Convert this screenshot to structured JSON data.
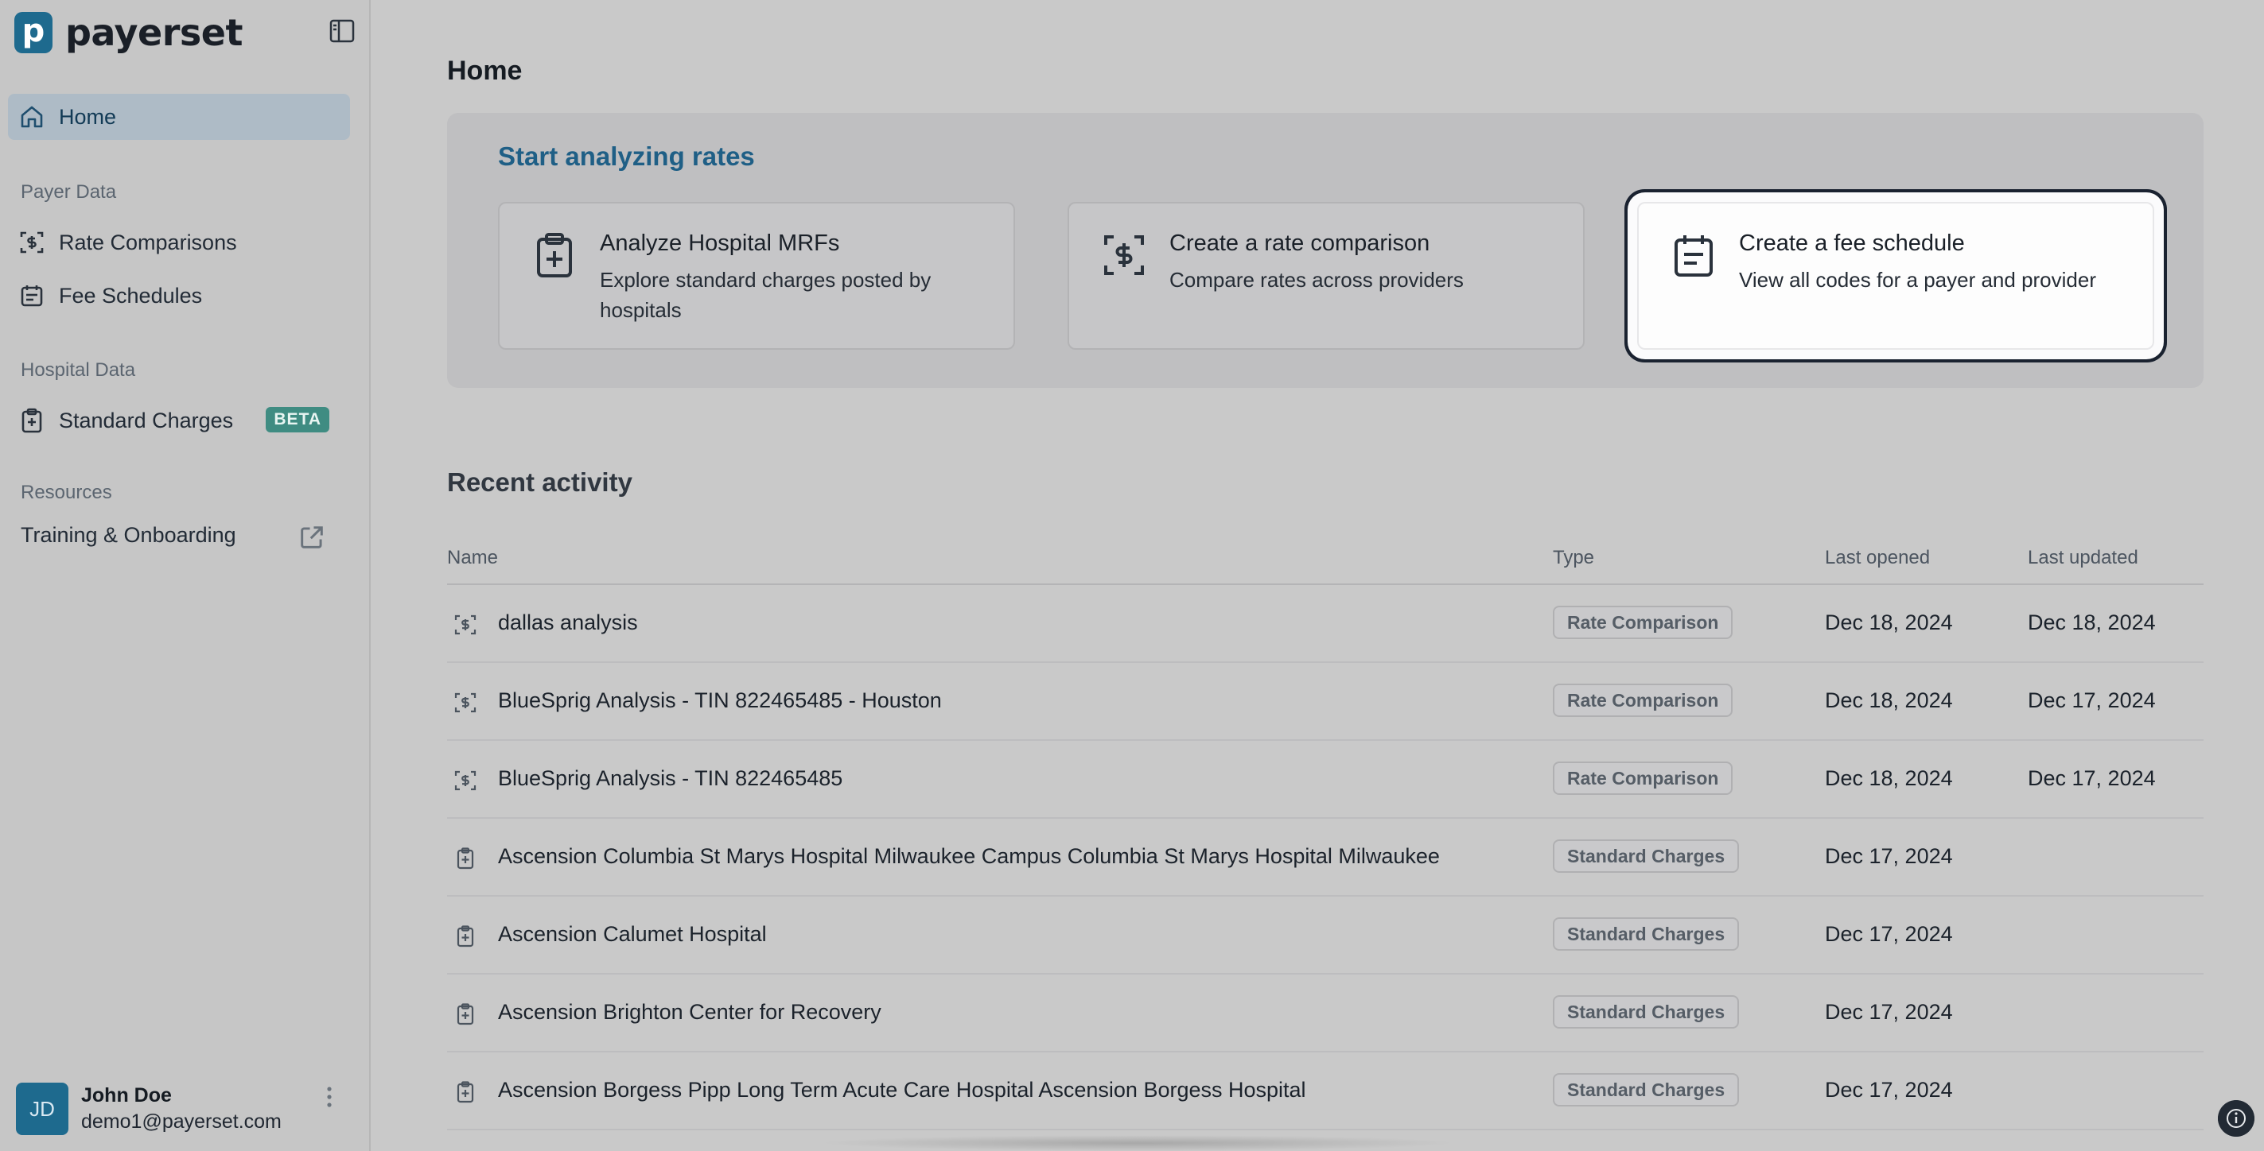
{
  "app": {
    "name": "payerset",
    "logo_letter": "p"
  },
  "sidebar": {
    "home_label": "Home",
    "sections": [
      {
        "label": "Payer Data",
        "items": [
          {
            "label": "Rate Comparisons",
            "icon": "dollar-scan-icon"
          },
          {
            "label": "Fee Schedules",
            "icon": "calendar-list-icon"
          }
        ]
      },
      {
        "label": "Hospital Data",
        "items": [
          {
            "label": "Standard Charges",
            "icon": "clipboard-plus-icon",
            "badge": "BETA"
          }
        ]
      },
      {
        "label": "Resources",
        "items": [
          {
            "label": "Training & Onboarding",
            "icon": "external-link-icon"
          }
        ]
      }
    ],
    "user": {
      "initials": "JD",
      "name": "John Doe",
      "email": "demo1@payerset.com"
    }
  },
  "main": {
    "title": "Home",
    "hero": {
      "title": "Start analyzing rates",
      "cards": [
        {
          "title": "Analyze Hospital MRFs",
          "desc": "Explore standard charges posted by hospitals",
          "icon": "clipboard-plus-icon"
        },
        {
          "title": "Create a rate comparison",
          "desc": "Compare rates across providers",
          "icon": "dollar-scan-icon"
        },
        {
          "title": "Create a fee schedule",
          "desc": "View all codes for a payer and provider",
          "icon": "calendar-list-icon"
        }
      ]
    },
    "recent": {
      "title": "Recent activity",
      "columns": [
        "Name",
        "Type",
        "Last opened",
        "Last updated"
      ],
      "rows": [
        {
          "name": "dallas analysis",
          "type": "Rate Comparison",
          "opened": "Dec 18, 2024",
          "updated": "Dec 18, 2024"
        },
        {
          "name": "BlueSprig Analysis - TIN 822465485 - Houston",
          "type": "Rate Comparison",
          "opened": "Dec 18, 2024",
          "updated": "Dec 17, 2024"
        },
        {
          "name": "BlueSprig Analysis - TIN 822465485",
          "type": "Rate Comparison",
          "opened": "Dec 18, 2024",
          "updated": "Dec 17, 2024"
        },
        {
          "name": "Ascension Columbia St Marys Hospital Milwaukee Campus Columbia St Marys Hospital Milwaukee",
          "type": "Standard Charges",
          "opened": "Dec 17, 2024",
          "updated": ""
        },
        {
          "name": "Ascension Calumet Hospital",
          "type": "Standard Charges",
          "opened": "Dec 17, 2024",
          "updated": ""
        },
        {
          "name": "Ascension Brighton Center for Recovery",
          "type": "Standard Charges",
          "opened": "Dec 17, 2024",
          "updated": ""
        },
        {
          "name": "Ascension Borgess Pipp Long Term Acute Care Hospital Ascension Borgess Hospital",
          "type": "Standard Charges",
          "opened": "Dec 17, 2024",
          "updated": ""
        }
      ]
    }
  },
  "colors": {
    "brand": "#1e6a8e",
    "beta": "#3f8c82",
    "hero_title": "#1f5f86"
  }
}
